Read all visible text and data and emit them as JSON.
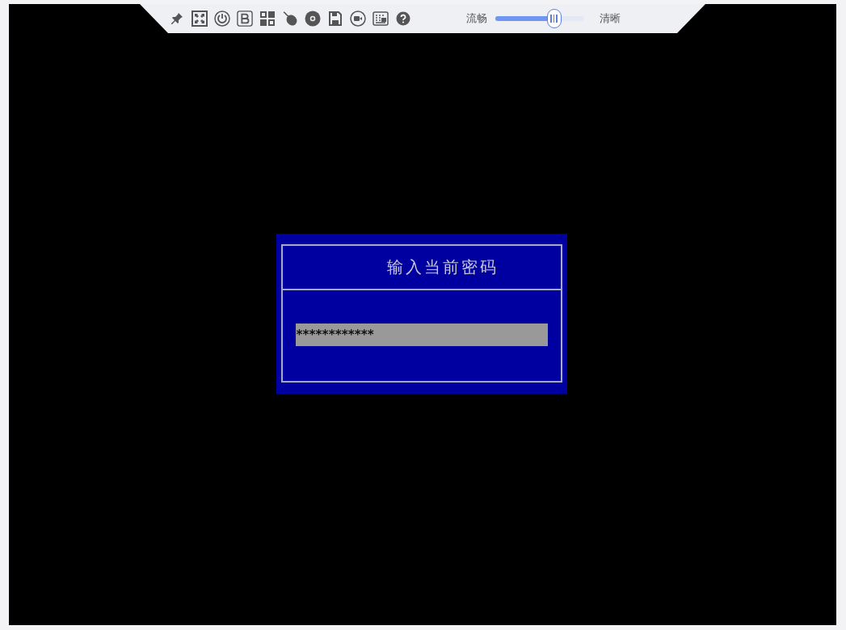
{
  "toolbar": {
    "quality": {
      "low_label": "流畅",
      "level": 0.66,
      "high_label": "清晰"
    }
  },
  "dialog": {
    "title": "输入当前密码",
    "password": "************"
  }
}
